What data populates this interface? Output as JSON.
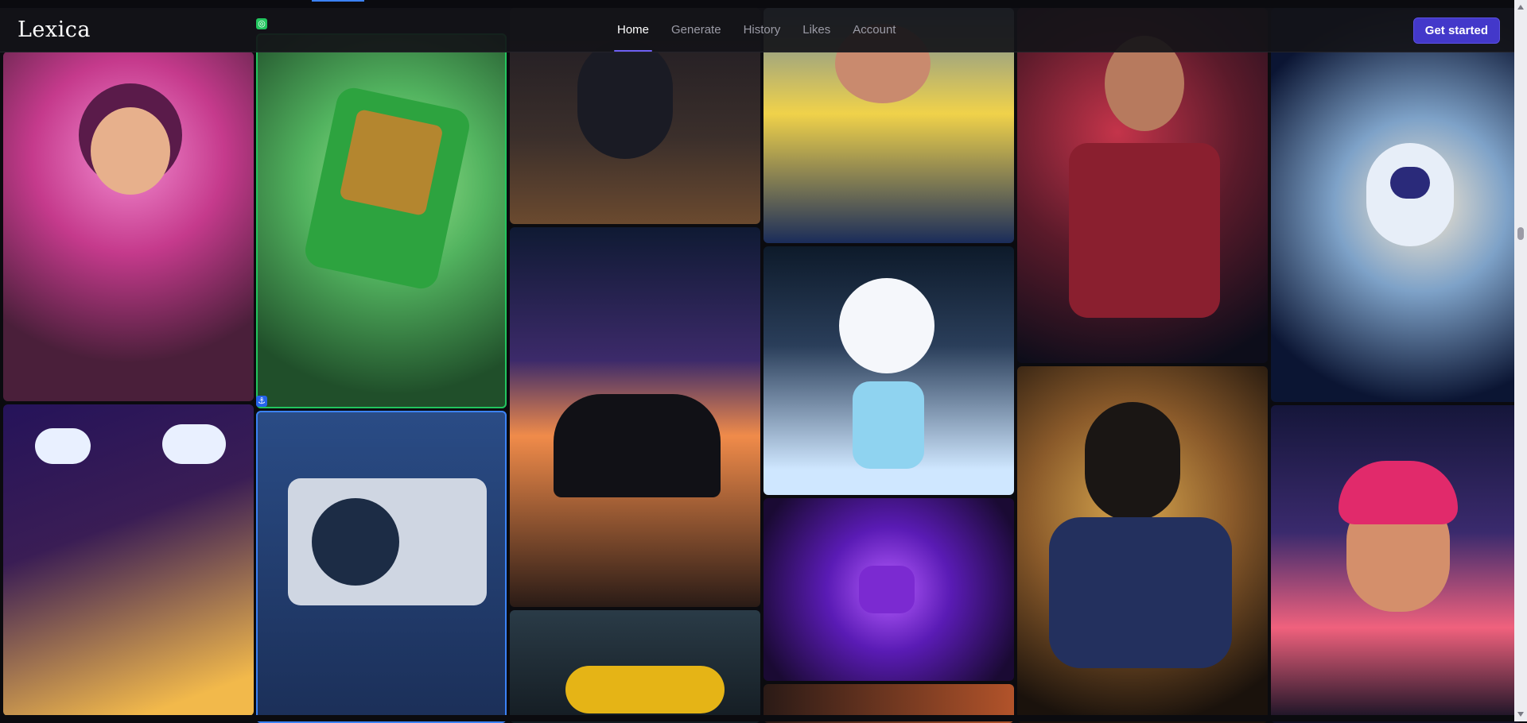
{
  "app": {
    "name": "Lexica"
  },
  "nav": {
    "items": [
      {
        "label": "Home",
        "active": true
      },
      {
        "label": "Generate",
        "active": false
      },
      {
        "label": "History",
        "active": false
      },
      {
        "label": "Likes",
        "active": false
      },
      {
        "label": "Account",
        "active": false
      }
    ],
    "cta_label": "Get started"
  },
  "gallery": {
    "columns": [
      {
        "tiles": [
          "cartoon-doctor-woman",
          "isometric-island-cars"
        ]
      },
      {
        "tiles": [
          "green-handheld-console",
          "white-camera"
        ]
      },
      {
        "tiles": [
          "cat-on-laptop",
          "sunset-friends",
          "motorcycle"
        ]
      },
      {
        "tiles": [
          "yellow-jacket-woman",
          "rabbit-astronaut-toy",
          "purple-mug-clouds",
          "shrine-road"
        ]
      },
      {
        "tiles": [
          "armored-hero-man",
          "dachshund-armor"
        ]
      },
      {
        "tiles": [
          "astronaut-planet",
          "neon-anime-man"
        ]
      }
    ]
  },
  "colors": {
    "accent": "#4338ca",
    "nav_active_underline": "#6d5ff3",
    "selection_green": "#22c55e",
    "selection_blue": "#3b82f6"
  },
  "icons": {
    "selection_target": "target-icon",
    "anchor": "anchor-icon"
  }
}
